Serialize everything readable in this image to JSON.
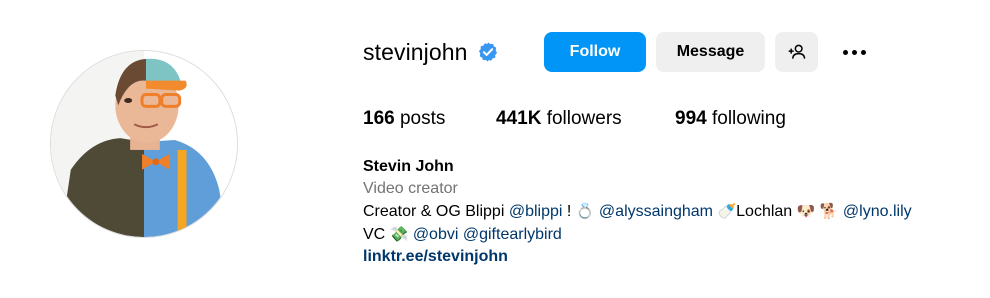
{
  "profile": {
    "username": "stevinjohn",
    "verified": true,
    "verified_color": "#3897f0"
  },
  "actions": {
    "follow_label": "Follow",
    "message_label": "Message",
    "add_user_icon": "add-user-icon",
    "more_icon": "more-options-icon"
  },
  "stats": {
    "posts_count": "166",
    "posts_label": "posts",
    "followers_count": "441K",
    "followers_label": "followers",
    "following_count": "994",
    "following_label": "following"
  },
  "bio": {
    "name": "Stevin John",
    "category": "Video creator",
    "line1": {
      "prefix": "Creator & OG Blippi ",
      "mention1": "@blippi",
      "text2": " ! ",
      "emoji_ring": "💍",
      "mention2": "@alyssaingham",
      "emoji_baby": "🍼",
      "text3": "Lochlan ",
      "emoji_dog1": "🐶",
      "emoji_dog2": "🐕",
      "mention3": "@lyno.lily"
    },
    "line2": {
      "prefix": "VC ",
      "emoji_money": "💸",
      "mention1": "@obvi",
      "mention2": "@giftearlybird"
    },
    "link": "linktr.ee/stevinjohn"
  },
  "colors": {
    "follow_bg": "#0095f6",
    "secondary_bg": "#efefef",
    "link_color": "#00376b",
    "muted_text": "#737373"
  }
}
